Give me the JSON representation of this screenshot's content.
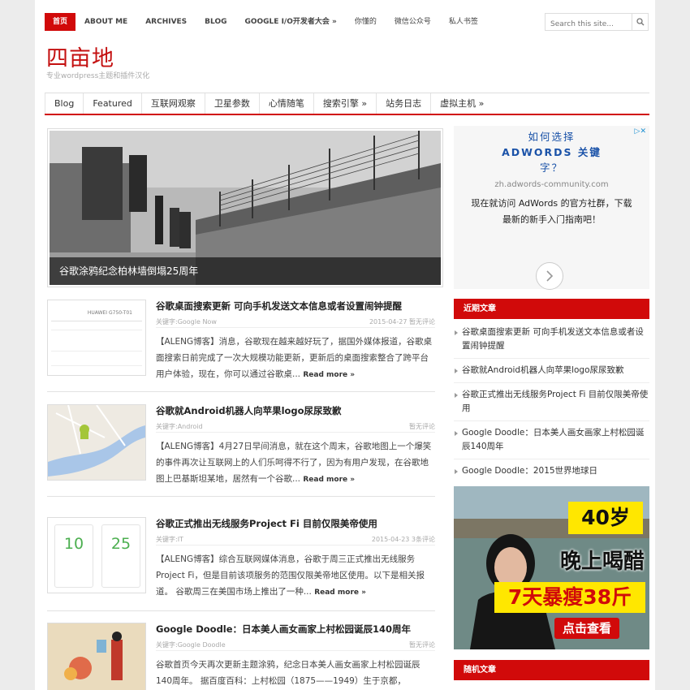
{
  "topnav": {
    "items": [
      "首页",
      "ABOUT ME",
      "ARCHIVES",
      "BLOG",
      "GOOGLE I/O开发者大会 »",
      "你懂的",
      "微信公众号",
      "私人书签"
    ]
  },
  "search": {
    "placeholder": "Search this site..."
  },
  "site": {
    "title": "四亩地",
    "tagline": "专业wordpress主题和插件汉化"
  },
  "mainnav": {
    "items": [
      "Blog",
      "Featured",
      "互联网观察",
      "卫星参数",
      "心情随笔",
      "搜索引擎 »",
      "站务日志",
      "虚拟主机 »"
    ]
  },
  "slider": {
    "caption": "谷歌涂鸦纪念柏林墙倒塌25周年"
  },
  "posts": [
    {
      "title": "谷歌桌面搜索更新 可向手机发送文本信息或者设置闹钟提醒",
      "tags": "关键字:Google Now",
      "date": "2015-04-27 暂无评论",
      "excerpt": "【ALENG博客】消息，谷歌现在越来越好玩了，据国外媒体报道，谷歌桌面搜索日前完成了一次大规模功能更新，更新后的桌面搜索整合了跨平台用户体验，现在，你可以通过谷歌桌...",
      "more": "Read more »",
      "thumb_text": "HUAWEI G750-T01"
    },
    {
      "title": "谷歌就Android机器人向苹果logo尿尿致歉",
      "tags": "关键字:Android",
      "date": "暂无评论",
      "excerpt": "【ALENG博客】4月27日早间消息，就在这个周末，谷歌地图上一个爆笑的事件再次让互联网上的人们乐呵得不行了，因为有用户发现，在谷歌地图上巴基斯坦某地，居然有一个谷歌...",
      "more": "Read more »"
    },
    {
      "title": "谷歌正式推出无线服务Project Fi 目前仅限美帝使用",
      "tags": "关键字:IT",
      "date": "2015-04-23 3条评论",
      "excerpt": "【ALENG博客】综合互联网媒体消息，谷歌于周三正式推出无线服务Project Fi，但是目前该项服务的范围仅限美帝地区使用。以下是相关报道。 谷歌周三在美国市场上推出了一种...",
      "more": "Read more »",
      "thumb_a": "10",
      "thumb_b": "25"
    },
    {
      "title": "Google Doodle：日本美人画女画家上村松园诞辰140周年",
      "tags": "关键字:Google Doodle",
      "date": "暂无评论",
      "excerpt": "谷歌首页今天再次更新主题涂鸦，纪念日本美人画女画家上村松园诞辰140周年。 据百度百科：上村松园（1875——1949）生于京都，",
      "more": ""
    }
  ],
  "ad": {
    "headline_1": "如何选择",
    "headline_2": "ADWORDS 关键",
    "headline_3": "字？",
    "url": "zh.adwords-community.com",
    "body": "现在就访问 AdWords 的官方社群，下载最新的新手入门指南吧！",
    "close_icon": "close-icon"
  },
  "recent": {
    "title": "近期文章",
    "items": [
      "谷歌桌面搜索更新 可向手机发送文本信息或者设置闹钟提醒",
      "谷歌就Android机器人向苹果logo尿尿致歉",
      "谷歌正式推出无线服务Project Fi 目前仅限美帝使用",
      "Google Doodle：日本美人画女画家上村松园诞辰140周年",
      "Google Doodle：2015世界地球日"
    ]
  },
  "image_ad": {
    "line1": "40岁",
    "line2": "晚上喝醋",
    "line3": "7天暴瘦38斤",
    "button": "点击查看"
  },
  "random": {
    "title": "随机文章"
  },
  "colors": {
    "accent": "#d10a0a",
    "link_blue": "#1a52a8"
  }
}
